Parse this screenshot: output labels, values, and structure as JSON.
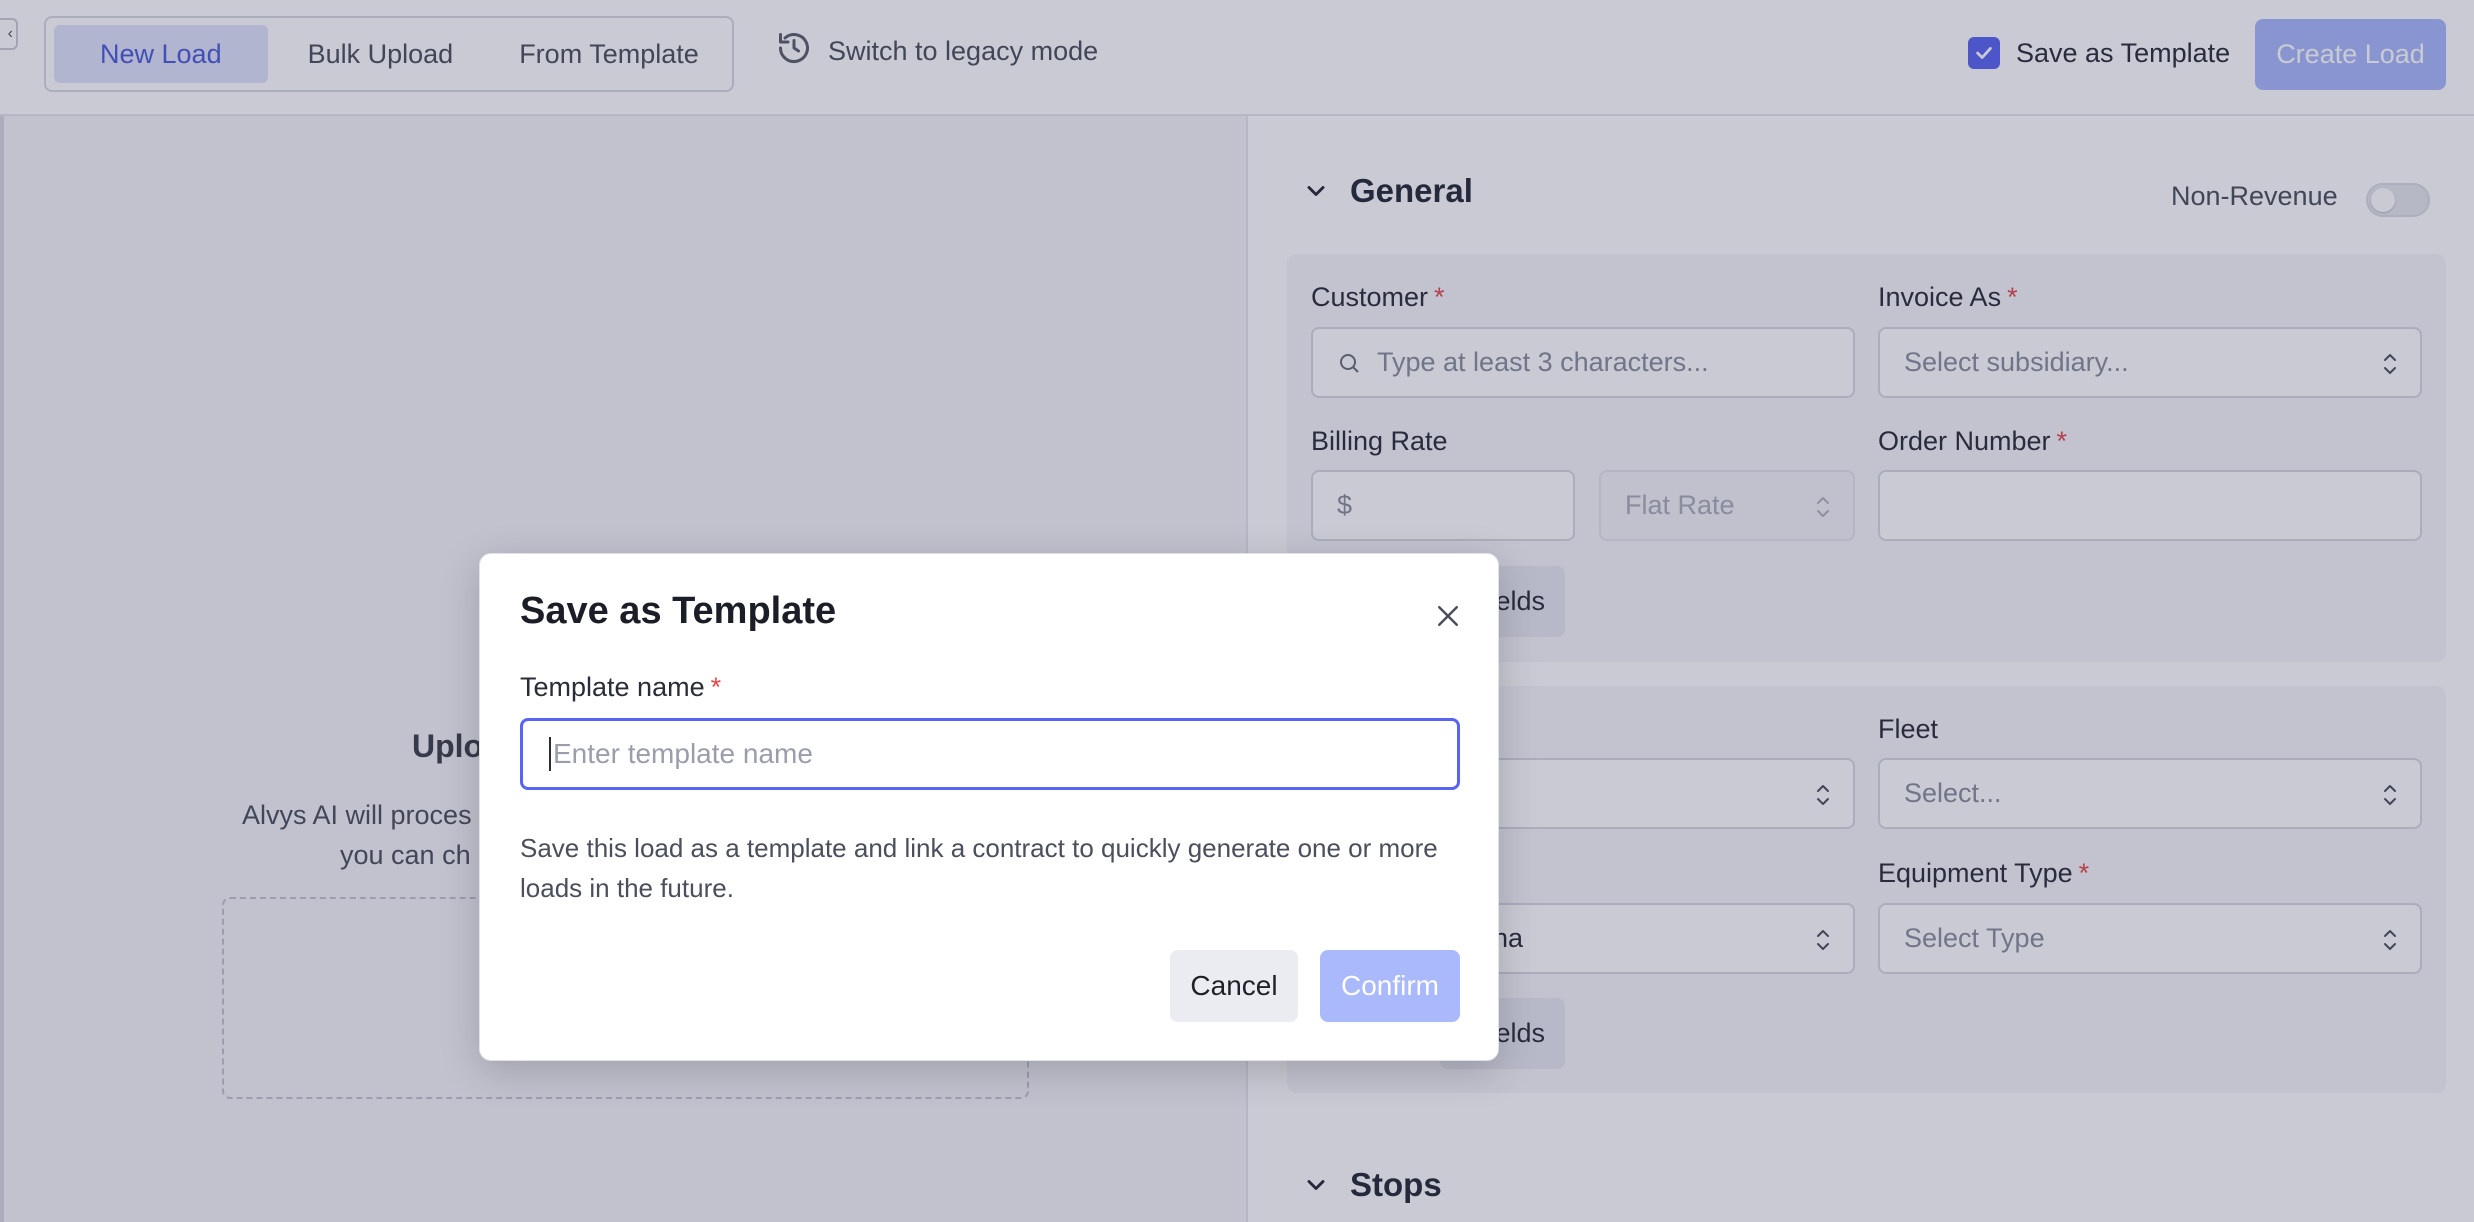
{
  "topbar": {
    "tabs": [
      {
        "label": "New Load",
        "active": true
      },
      {
        "label": "Bulk Upload",
        "active": false
      },
      {
        "label": "From Template",
        "active": false
      }
    ],
    "legacy_label": "Switch to legacy mode",
    "legacy_icon": "history-icon",
    "save_template_label": "Save as Template",
    "save_template_checked": true,
    "create_load_label": "Create Load",
    "accent_color": "#5865f2"
  },
  "left": {
    "upload_title": "Uplo",
    "upload_desc_line1": "Alvys AI will proces",
    "upload_desc_line2": "you can ch"
  },
  "general": {
    "title": "General",
    "non_revenue_label": "Non-Revenue",
    "non_revenue_on": false,
    "customer_label": "Customer",
    "customer_placeholder": "Type at least 3 characters...",
    "invoice_as_label": "Invoice As",
    "invoice_as_placeholder": "Select subsidiary...",
    "billing_rate_label": "Billing Rate",
    "billing_rate_prefix": "$",
    "rate_type_value": "Flat Rate",
    "order_number_label": "Order Number",
    "more_fields_label": "elds"
  },
  "fleet_card": {
    "fleet_label": "Fleet",
    "fleet_placeholder": "Select...",
    "partial_select_value": "na",
    "equipment_type_label": "Equipment Type",
    "equipment_type_placeholder": "Select Type",
    "more_fields_label": "elds"
  },
  "stops": {
    "title": "Stops"
  },
  "modal": {
    "title": "Save as Template",
    "field_label": "Template name",
    "required_mark": "*",
    "placeholder": "Enter template name",
    "description": "Save this load as a template and link a contract to quickly generate one or more loads in the future.",
    "cancel_label": "Cancel",
    "confirm_label": "Confirm"
  }
}
